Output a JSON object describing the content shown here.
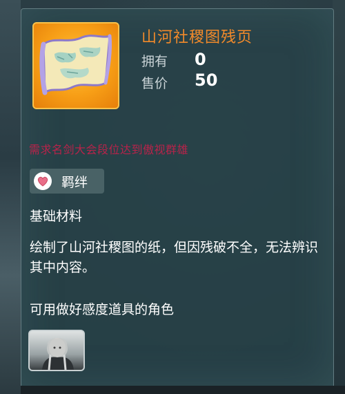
{
  "item": {
    "name": "山河社稷图残页",
    "icon": "scroll-map-icon",
    "owned_label": "拥有",
    "owned_value": "0",
    "price_label": "售价",
    "price_value": "50"
  },
  "requirement_text": "需求名剑大会段位达到傲视群雄",
  "tag": {
    "icon": "heart-icon",
    "label": "羁绊"
  },
  "item_type": "基础材料",
  "description": "绘制了山河社稷图的纸，但因残破不全，无法辨识其中内容。",
  "usable_by_label": "可用做好感度道具的角色",
  "characters": [
    {
      "portrait": "character-portrait"
    }
  ],
  "colors": {
    "item_name": "#f28a2a",
    "requirement": "#b8234a",
    "icon_frame": "#f79e16"
  }
}
